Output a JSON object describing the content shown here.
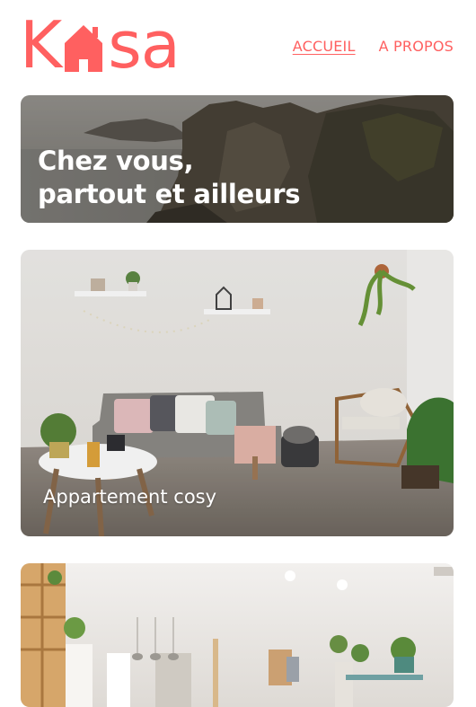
{
  "brand": {
    "logo_letters": [
      "K",
      "sa"
    ],
    "accent": "#ff6060"
  },
  "nav": {
    "items": [
      {
        "label": "ACCUEIL",
        "active": true
      },
      {
        "label": "A PROPOS",
        "active": false
      }
    ]
  },
  "hero": {
    "title": "Chez vous,\npartout et ailleurs"
  },
  "listings": [
    {
      "title": "Appartement cosy"
    },
    {
      "title": ""
    }
  ]
}
